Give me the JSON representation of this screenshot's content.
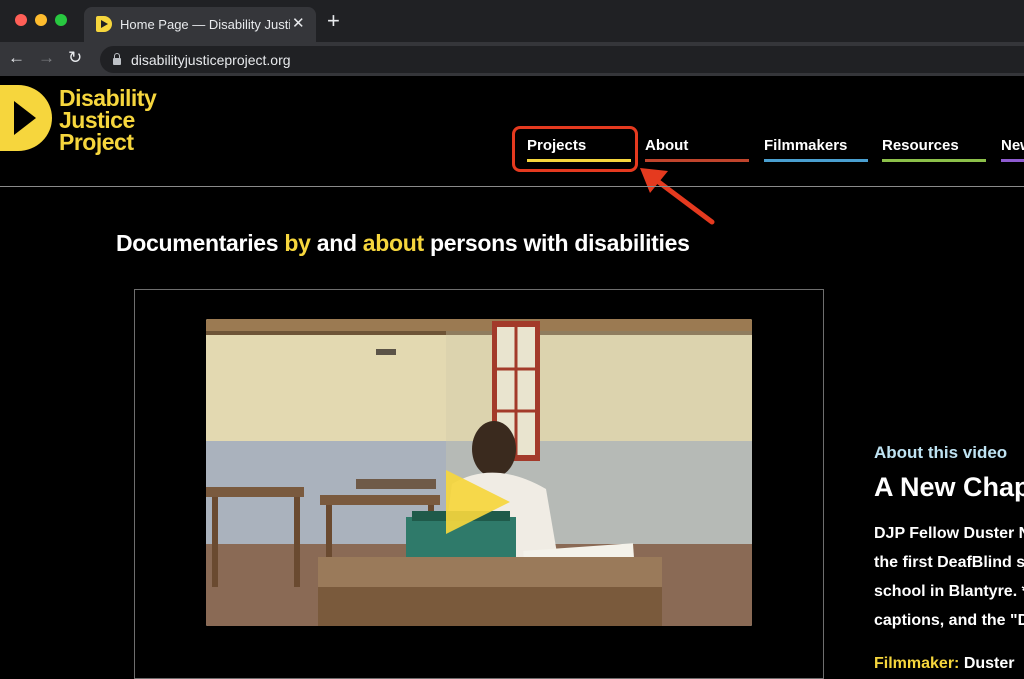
{
  "browser": {
    "tab_title": "Home Page — Disability Justice Project",
    "new_tab_symbol": "+",
    "url": "disabilityjusticeproject.org",
    "accent": "#35363a"
  },
  "site": {
    "logo_lines": [
      "Disability",
      "Justice",
      "Project"
    ],
    "brand_color": "#f6d63d",
    "nav": [
      {
        "label": "Projects",
        "color": "#f6d63d"
      },
      {
        "label": "About",
        "color": "#c0442c"
      },
      {
        "label": "Filmmakers",
        "color": "#4a9fd0"
      },
      {
        "label": "Resources",
        "color": "#8cc04a"
      },
      {
        "label": "News",
        "color": "#8e5bd0"
      }
    ],
    "annotation_color": "#e53a1f"
  },
  "main": {
    "headline": {
      "part1": "Documentaries ",
      "highlight1": "by",
      "part2": " and ",
      "highlight2": "about",
      "part3": " persons with disabilities"
    },
    "video": {
      "about_label": "About this video",
      "title": "A New Chapter",
      "description_lines": [
        "DJP Fellow Duster Ndalama",
        "the first DeafBlind student",
        "school in Blantyre. *",
        "captions, and the \"D"
      ],
      "filmmaker_label": "Filmmaker:",
      "filmmaker_name": " Duster"
    }
  }
}
